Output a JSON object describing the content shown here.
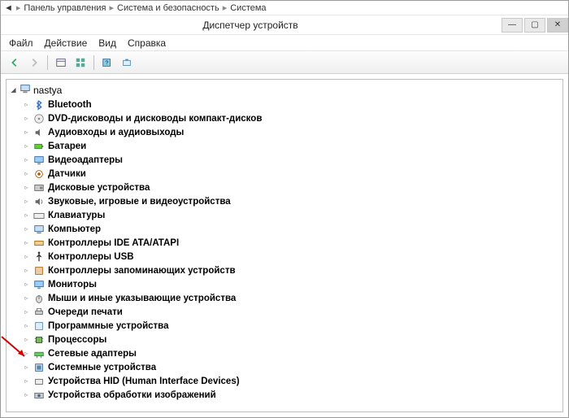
{
  "breadcrumb": {
    "part1": "Панель управления",
    "part2": "Система и безопасность",
    "part3": "Система"
  },
  "window": {
    "title": "Диспетчер устройств"
  },
  "menu": {
    "file": "Файл",
    "action": "Действие",
    "view": "Вид",
    "help": "Справка"
  },
  "root": {
    "name": "nastya"
  },
  "categories": [
    {
      "label": "Bluetooth",
      "icon": "bluetooth"
    },
    {
      "label": "DVD-дисководы и дисководы компакт-дисков",
      "icon": "disc"
    },
    {
      "label": "Аудиовходы и аудиовыходы",
      "icon": "audio-io"
    },
    {
      "label": "Батареи",
      "icon": "battery"
    },
    {
      "label": "Видеоадаптеры",
      "icon": "display"
    },
    {
      "label": "Датчики",
      "icon": "sensor"
    },
    {
      "label": "Дисковые устройства",
      "icon": "hdd"
    },
    {
      "label": "Звуковые, игровые и видеоустройства",
      "icon": "sound"
    },
    {
      "label": "Клавиатуры",
      "icon": "keyboard"
    },
    {
      "label": "Компьютер",
      "icon": "computer"
    },
    {
      "label": "Контроллеры IDE ATA/ATAPI",
      "icon": "ide"
    },
    {
      "label": "Контроллеры USB",
      "icon": "usb"
    },
    {
      "label": "Контроллеры запоминающих устройств",
      "icon": "storage"
    },
    {
      "label": "Мониторы",
      "icon": "monitor"
    },
    {
      "label": "Мыши и иные указывающие устройства",
      "icon": "mouse"
    },
    {
      "label": "Очереди печати",
      "icon": "printer"
    },
    {
      "label": "Программные устройства",
      "icon": "software"
    },
    {
      "label": "Процессоры",
      "icon": "cpu"
    },
    {
      "label": "Сетевые адаптеры",
      "icon": "network"
    },
    {
      "label": "Системные устройства",
      "icon": "system"
    },
    {
      "label": "Устройства HID (Human Interface Devices)",
      "icon": "hid"
    },
    {
      "label": "Устройства обработки изображений",
      "icon": "imaging"
    }
  ],
  "highlighted_index": 21,
  "colors": {
    "arrow": "#d40000"
  }
}
